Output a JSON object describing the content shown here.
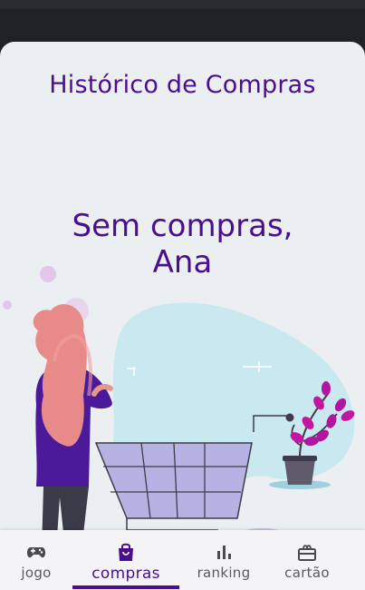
{
  "header": {
    "title": "Histórico de Compras"
  },
  "empty_state": {
    "line1": "Sem compras,",
    "line2": "Ana"
  },
  "bottom_nav": {
    "items": [
      {
        "label": "jogo",
        "icon": "gamepad-icon",
        "active": false
      },
      {
        "label": "compras",
        "icon": "shopping-bag-icon",
        "active": true
      },
      {
        "label": "ranking",
        "icon": "bar-chart-icon",
        "active": false
      },
      {
        "label": "cartão",
        "icon": "card-icon",
        "active": false
      }
    ]
  },
  "colors": {
    "accent": "#4a0e8f",
    "background": "#eceff1",
    "nav_bg": "#f4f4f6"
  }
}
